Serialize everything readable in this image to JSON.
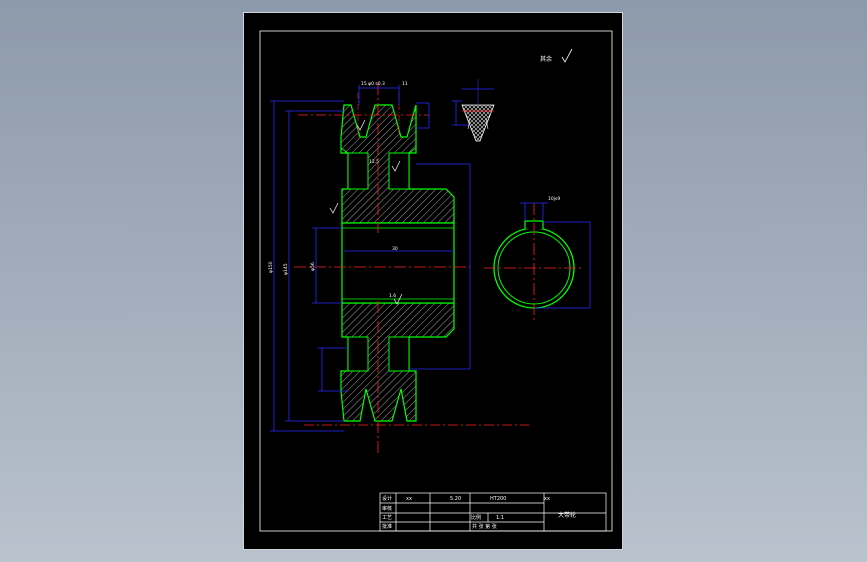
{
  "colors": {
    "sheet": "#000000",
    "outline": "#00ff00",
    "hatch": "#cfcfcf",
    "center": "#ff2020",
    "dimension": "#2a2aff",
    "text": "#ffffff"
  },
  "surface_notes": {
    "top_right_mark": "其余",
    "roughness_a": "12.5",
    "roughness_b": "1.6"
  },
  "dimensions": {
    "bore": "30",
    "pitch_dia": "φ145",
    "outer_dia": "φ150",
    "hub_dia": "φ56",
    "keyway_width": "10js9",
    "groove_top": "15 φ0 s0.3",
    "groove_width": "11"
  },
  "title_block": {
    "designed_label": "设计",
    "designed_by": "xx",
    "checked_label": "审核",
    "process_label": "工艺",
    "approved_label": "批准",
    "date": "5.20",
    "material": "HT200",
    "scale_label": "比例",
    "scale": "1:1",
    "drawing_code": "xx",
    "part_name": "大带轮",
    "sheet_info": "共 张 第 张"
  }
}
